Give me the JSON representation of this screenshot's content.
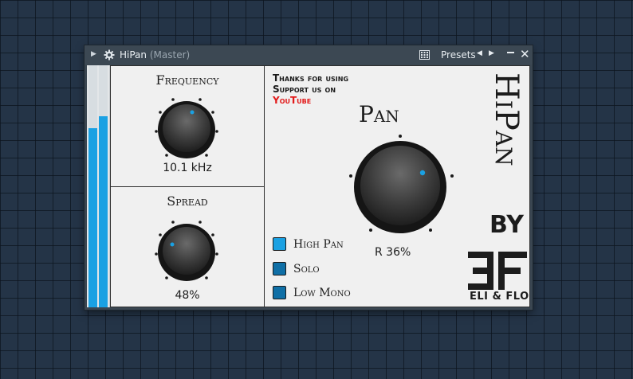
{
  "window": {
    "title": "HiPan",
    "subtitle": "(Master)",
    "presets_label": "Presets"
  },
  "meters": {
    "left_level": 0.74,
    "right_level": 0.79
  },
  "frequency": {
    "label": "Frequency",
    "value": "10.1 kHz"
  },
  "spread": {
    "label": "Spread",
    "value": "48%"
  },
  "pan": {
    "label": "Pan",
    "value": "R 36%"
  },
  "support": {
    "line1": "Thanks for using",
    "line2": "Support us on",
    "link": "YouTube"
  },
  "options": [
    {
      "label": "High Pan",
      "checked": true
    },
    {
      "label": "Solo",
      "checked": false
    },
    {
      "label": "Low Mono",
      "checked": false
    }
  ],
  "brand": {
    "name": "HiPan",
    "by": "BY",
    "logo": "EF",
    "company": "ELI & FLO"
  },
  "colors": {
    "accent": "#1aa1e3",
    "accent_dark": "#0f6fa6",
    "link": "#e21a1a",
    "titlebar": "#3c4853",
    "panel": "#f0f0f0"
  }
}
